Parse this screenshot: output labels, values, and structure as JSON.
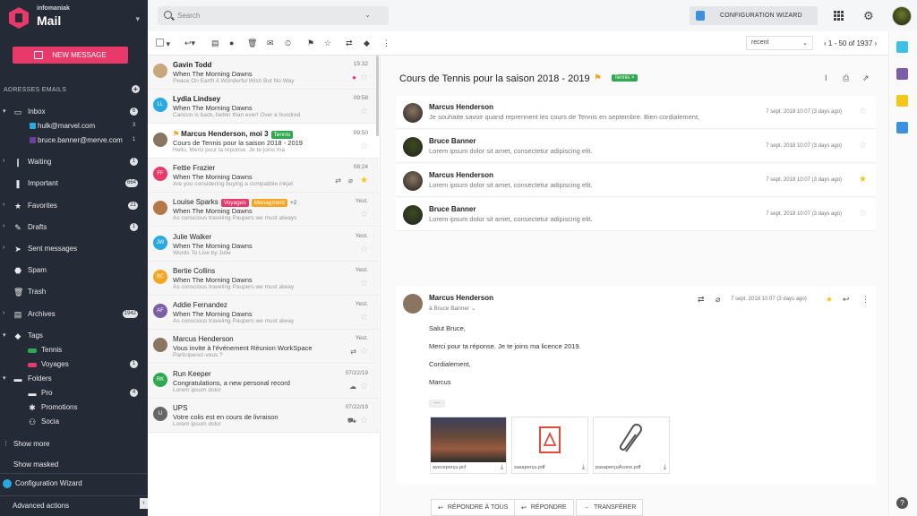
{
  "brand": {
    "org": "infomaniak",
    "app": "Mail"
  },
  "sidebar": {
    "new_message": "NEW MESSAGE",
    "section_addresses": "ADRESSES EMAILS",
    "inbox": {
      "label": "Inbox",
      "count": "6"
    },
    "accounts": [
      {
        "label": "hulk@marvel.com",
        "count": "3",
        "color": "#2aa8e0"
      },
      {
        "label": "bruce.banner@merve.com",
        "count": "1",
        "color": "#6b3fa0"
      }
    ],
    "folders_main": [
      {
        "label": "Waiting",
        "count": "1",
        "icon": "chevron-right-icon"
      },
      {
        "label": "Important",
        "count": "664",
        "icon": "important-icon"
      },
      {
        "label": "Favorites",
        "count": "21",
        "icon": "star-icon"
      },
      {
        "label": "Drafts",
        "count": "1",
        "icon": "draft-icon"
      },
      {
        "label": "Sent messages",
        "count": "",
        "icon": "send-icon"
      },
      {
        "label": "Spam",
        "count": "",
        "icon": "spam-icon"
      },
      {
        "label": "Trash",
        "count": "",
        "icon": "trash-icon"
      },
      {
        "label": "Archives",
        "count": "1942",
        "icon": "archive-icon"
      }
    ],
    "tags": {
      "label": "Tags",
      "items": [
        {
          "label": "Tennis",
          "count": "",
          "color": "#2fa84f"
        },
        {
          "label": "Voyages",
          "count": "1",
          "color": "#e8396a"
        }
      ]
    },
    "folders": {
      "label": "Folders",
      "items": [
        {
          "label": "Pro",
          "count": "4"
        },
        {
          "label": "Promotions",
          "count": ""
        },
        {
          "label": "Socia",
          "count": ""
        }
      ]
    },
    "show_more": "Show more",
    "show_masked": "Show masked",
    "config_wizard": "Configuration Wizard",
    "advanced_actions": "Advanced actions"
  },
  "topbar": {
    "search_placeholder": "Search",
    "wizard": "CONFIGURATION WIZARD"
  },
  "toolbar": {
    "sort": "recent",
    "pager": "1 - 50 of 1937"
  },
  "mails": [
    {
      "from": "Gavin Todd",
      "subject": "When The Morning Dawns",
      "preview": "Peace On Earth A Wonderful Wish But No Way",
      "time": "15:32",
      "bold": true,
      "read": false,
      "avatar_color": "#c9a77c",
      "initials": "",
      "star": false
    },
    {
      "from": "Lydia Lindsey",
      "subject": "When The Morning Dawns",
      "preview": "Cancun is back, better than ever! Over a hundred",
      "time": "09:58",
      "bold": true,
      "read": false,
      "avatar_color": "#2aa8e0",
      "initials": "LL",
      "star": false
    },
    {
      "from": "Marcus Henderson, moi 3",
      "subject": "Cours de Tennis pour la saison 2018 - 2019",
      "preview": "Hello, Merci pour la réponse. Je te joins ma",
      "time": "09:50",
      "bold": true,
      "read": true,
      "avatar_color": "#8a7560",
      "initials": "",
      "star": false,
      "tag": "Tennis",
      "tag_color": "#2fa84f",
      "flag": true
    },
    {
      "from": "Fettie Frazier",
      "subject": "When The Morning Dawns",
      "preview": "Are you considering buying a compatible inkjet",
      "time": "08:24",
      "bold": false,
      "read": false,
      "avatar_color": "#e8396a",
      "initials": "FF",
      "star": true
    },
    {
      "from": "Louise Sparks",
      "subject": "When The Morning Dawns",
      "preview": "As conscious traveling Paupers we must always",
      "time": "Yest.",
      "bold": false,
      "read": false,
      "avatar_color": "#b5784a",
      "initials": "",
      "star": false,
      "tags": [
        {
          "label": "Voyages",
          "color": "#e8396a"
        },
        {
          "label": "Managment",
          "color": "#f5a623"
        }
      ],
      "more": "+2"
    },
    {
      "from": "Julie Walker",
      "subject": "When The Morning Dawns",
      "preview": "Words To Live by Julie",
      "time": "Yest.",
      "bold": false,
      "read": false,
      "avatar_color": "#2aa8e0",
      "initials": "JW",
      "star": false
    },
    {
      "from": "Bertie Collins",
      "subject": "When The Morning Dawns",
      "preview": "As conscious traveling Paupers we must alway",
      "time": "Yest.",
      "bold": false,
      "read": false,
      "avatar_color": "#f5a623",
      "initials": "BC",
      "star": false
    },
    {
      "from": "Addie Fernandez",
      "subject": "When The Morning Dawns",
      "preview": "As conscious traveling Paupers we must alway",
      "time": "Yest.",
      "bold": false,
      "read": false,
      "avatar_color": "#7b5ea7",
      "initials": "AF",
      "star": false
    },
    {
      "from": "Marcus Henderson",
      "subject": "Vous invite à l'événement Réunion WorkSpace",
      "preview": "Participerez-vous ?",
      "time": "Yest.",
      "bold": false,
      "read": false,
      "avatar_color": "#8a7560",
      "initials": "",
      "star": false
    },
    {
      "from": "Run Keeper",
      "subject": "Congratulations, a new personal record",
      "preview": "Lorem ipsum dolor",
      "time": "07/22/19",
      "bold": false,
      "read": false,
      "avatar_color": "#2fa84f",
      "initials": "RK",
      "star": false
    },
    {
      "from": "UPS",
      "subject": "Votre colis est en cours de livraison",
      "preview": "Lorem ipsum dolor",
      "time": "07/22/19",
      "bold": false,
      "read": false,
      "avatar_color": "#666",
      "initials": "U",
      "star": false
    }
  ],
  "thread": {
    "title": "Cours de Tennis pour la saison 2018 - 2019",
    "tag": "Tennis ×",
    "messages": [
      {
        "from": "Marcus Henderson",
        "preview": "Je souhaite savoir quand reprennent les cours de Tennis en septembre. Bien cordialement,",
        "date": "7 sept. 2018 10:07 (3 days ago)",
        "star": false,
        "avatar": "#8a7560"
      },
      {
        "from": "Bruce Banner",
        "preview": "Lorem ipsum dolor sit amet, consectetur adipiscing elit.",
        "date": "7 sept. 2018 10:07 (3 days ago)",
        "star": false,
        "avatar": "#3d4a1e"
      },
      {
        "from": "Marcus Henderson",
        "preview": "Lorem ipsum dolor sit amet, consectetur adipiscing elit.",
        "date": "7 sept. 2018 10:07 (3 days ago)",
        "star": true,
        "avatar": "#8a7560"
      },
      {
        "from": "Bruce Banner",
        "preview": "Lorem ipsum dolor sit amet, consectetur adipiscing elit.",
        "date": "7 sept. 2018 10:07 (3 days ago)",
        "star": false,
        "avatar": "#3d4a1e"
      }
    ],
    "open": {
      "from": "Marcus Henderson",
      "to": "à Bruce Banner",
      "date": "7 sept. 2018 10:07 (3 days ago)",
      "greeting": "Salut Bruce,",
      "line1": "Merci pour ta réponse. Je te joins ma licence 2019.",
      "line2": "Cordialement,",
      "signature": "Marcus",
      "attachments": [
        {
          "name": "aveceperçu.pcf"
        },
        {
          "name": "sasaperçu.pdf"
        },
        {
          "name": "pasaperçuAcone.pdf"
        }
      ]
    },
    "reply_all": "RÉPONDRE À TOUS",
    "reply": "RÉPONDRE",
    "forward": "TRANSFÉRER"
  }
}
